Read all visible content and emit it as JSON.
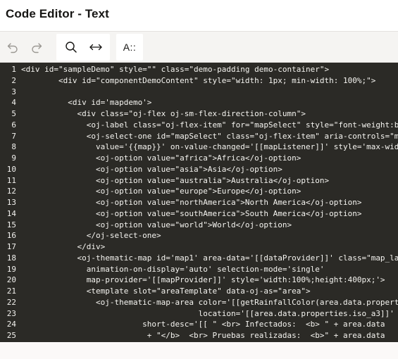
{
  "header": {
    "title": "Code Editor - Text"
  },
  "toolbar": {
    "undo": "undo-icon",
    "redo": "redo-icon",
    "search": "search-icon",
    "wrap": "wrap-icon",
    "font_label": "A::"
  },
  "editor": {
    "lines": [
      {
        "n": "1",
        "text": "<div id=\"sampleDemo\" style=\"\" class=\"demo-padding demo-container\">"
      },
      {
        "n": "2",
        "text": "        <div id=\"componentDemoContent\" style=\"width: 1px; min-width: 100%;\">"
      },
      {
        "n": "3",
        "text": ""
      },
      {
        "n": "4",
        "text": "          <div id='mapdemo'>"
      },
      {
        "n": "5",
        "text": "            <div class=\"oj-flex oj-sm-flex-direction-column\">"
      },
      {
        "n": "6",
        "text": "              <oj-label class=\"oj-flex-item\" for=\"mapSelect\" style=\"font-weight:bold\""
      },
      {
        "n": "7",
        "text": "              <oj-select-one id=\"mapSelect\" class=\"oj-flex-item\" aria-controls=\"map"
      },
      {
        "n": "8",
        "text": "                value='{{map}}' on-value-changed='[[mapListener]]' style='max-wid"
      },
      {
        "n": "9",
        "text": "                <oj-option value=\"africa\">Africa</oj-option>"
      },
      {
        "n": "10",
        "text": "                <oj-option value=\"asia\">Asia</oj-option>"
      },
      {
        "n": "11",
        "text": "                <oj-option value=\"australia\">Australia</oj-option>"
      },
      {
        "n": "12",
        "text": "                <oj-option value=\"europe\">Europe</oj-option>"
      },
      {
        "n": "13",
        "text": "                <oj-option value=\"northAmerica\">North America</oj-option>"
      },
      {
        "n": "14",
        "text": "                <oj-option value=\"southAmerica\">South America</oj-option>"
      },
      {
        "n": "15",
        "text": "                <oj-option value=\"world\">World</oj-option>"
      },
      {
        "n": "16",
        "text": "              </oj-select-one>"
      },
      {
        "n": "17",
        "text": "            </div>"
      },
      {
        "n": "18",
        "text": "            <oj-thematic-map id='map1' area-data='[[dataProvider]]' class=\"map_la"
      },
      {
        "n": "19",
        "text": "              animation-on-display='auto' selection-mode='single'"
      },
      {
        "n": "20",
        "text": "              map-provider='[[mapProvider]]' style='width:100%;height:400px;'>"
      },
      {
        "n": "21",
        "text": "              <template slot=\"areaTemplate\" data-oj-as=\"area\">"
      },
      {
        "n": "22",
        "text": "                <oj-thematic-map-area color='[[getRainfallColor(area.data.propert"
      },
      {
        "n": "23",
        "text": "                                      location='[[area.data.properties.iso_a3]]'"
      },
      {
        "n": "24",
        "text": "                          short-desc='[[ \" <br> Infectados:  <b> \" + area.data"
      },
      {
        "n": "25",
        "text": "                           + \"</b>  <br> Pruebas realizadas:  <b>\" + area.data"
      }
    ]
  }
}
